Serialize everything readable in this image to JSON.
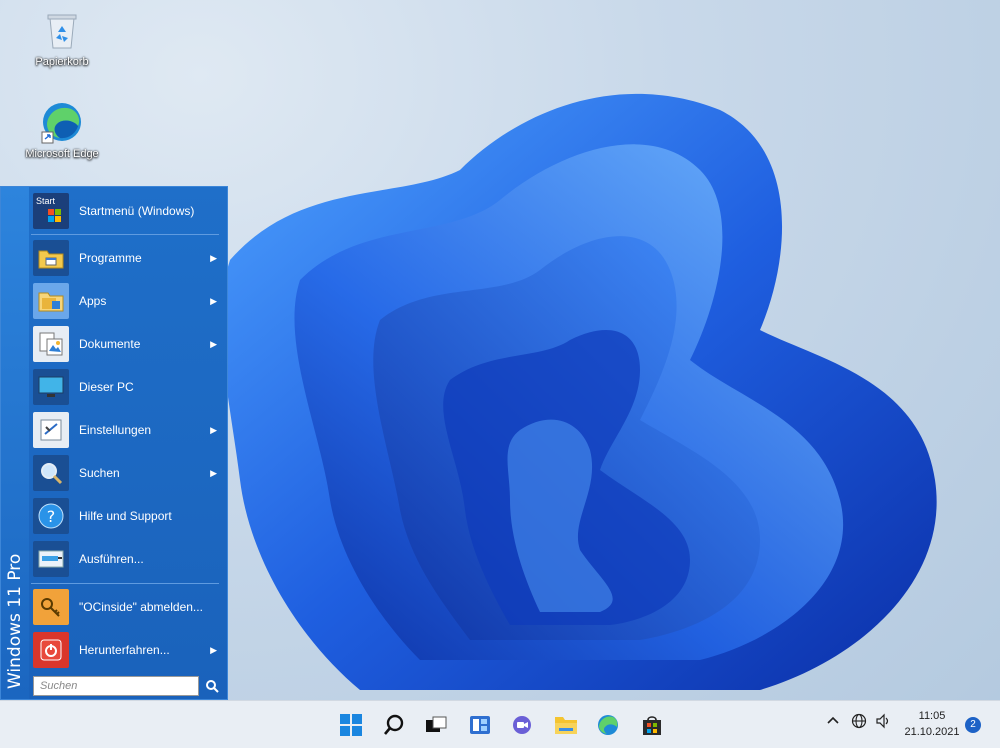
{
  "desktop": {
    "icons": [
      {
        "label": "Papierkorb",
        "icon": "recycle-bin-icon"
      },
      {
        "label": "Microsoft Edge",
        "icon": "edge-icon"
      }
    ]
  },
  "start_menu": {
    "side_text": "Windows 11 Pro",
    "header": {
      "label": "Startmenü (Windows)",
      "icon_text": "Start"
    },
    "items": [
      {
        "label": "Programme",
        "icon": "programs-icon",
        "submenu": true
      },
      {
        "label": "Apps",
        "icon": "apps-folder-icon",
        "submenu": true
      },
      {
        "label": "Dokumente",
        "icon": "documents-icon",
        "submenu": true
      },
      {
        "label": "Dieser PC",
        "icon": "monitor-icon",
        "submenu": false
      },
      {
        "label": "Einstellungen",
        "icon": "settings-icon",
        "submenu": true
      },
      {
        "label": "Suchen",
        "icon": "magnifier-icon",
        "submenu": true
      },
      {
        "label": "Hilfe und Support",
        "icon": "help-icon",
        "submenu": false
      },
      {
        "label": "Ausführen...",
        "icon": "run-icon",
        "submenu": false
      }
    ],
    "bottom_items": [
      {
        "label": "\"OCinside\" abmelden...",
        "icon": "logoff-key-icon",
        "submenu": false
      },
      {
        "label": "Herunterfahren...",
        "icon": "power-icon",
        "submenu": true
      }
    ],
    "search_placeholder": "Suchen"
  },
  "taskbar": {
    "clock_time": "11:05",
    "clock_date": "21.10.2021",
    "notification_count": "2"
  }
}
